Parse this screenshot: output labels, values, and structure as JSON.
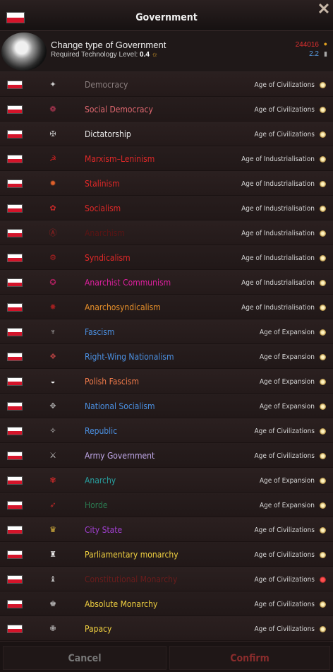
{
  "window": {
    "title": "Government"
  },
  "info": {
    "title": "Change type of Government",
    "req_label": "Required Technology Level: ",
    "req_value": "0.4",
    "gold": "244016",
    "time": "2.2"
  },
  "colors": {
    "gray": "#8a7f7f",
    "pink": "#e06870",
    "white": "#e8e8e8",
    "red": "#e02828",
    "darkred": "#5a1414",
    "magenta": "#e020a0",
    "orange": "#e8902a",
    "blue": "#4a8fe0",
    "salmon": "#f07a4a",
    "lavender": "#c0a8e8",
    "teal": "#28a0a0",
    "green": "#2a7a50",
    "purple": "#a040d0",
    "gold": "#f0d040",
    "maroon": "#6a1c1c"
  },
  "governments": [
    {
      "name": "Democracy",
      "age": "Age of Civilizations",
      "color": "#8a7f7f",
      "icon": "democracy-icon",
      "glyph": "✦",
      "icon_color": "#cfcfcf",
      "locked": false
    },
    {
      "name": "Social Democracy",
      "age": "Age of Civilizations",
      "color": "#e06870",
      "icon": "social-democracy-icon",
      "glyph": "❁",
      "icon_color": "#c03a5a",
      "locked": false
    },
    {
      "name": "Dictatorship",
      "age": "Age of Civilizations",
      "color": "#e8e8e8",
      "icon": "dictatorship-icon",
      "glyph": "✠",
      "icon_color": "#bdbdbd",
      "locked": false
    },
    {
      "name": "Marxism–Leninism",
      "age": "Age of Industrialisation",
      "color": "#e02828",
      "icon": "marxism-leninism-icon",
      "glyph": "☭",
      "icon_color": "#d02020",
      "locked": false
    },
    {
      "name": "Stalinism",
      "age": "Age of Industrialisation",
      "color": "#e02828",
      "icon": "stalinism-icon",
      "glyph": "✹",
      "icon_color": "#e0602a",
      "locked": false
    },
    {
      "name": "Socialism",
      "age": "Age of Industrialisation",
      "color": "#e02828",
      "icon": "socialism-icon",
      "glyph": "✿",
      "icon_color": "#c02828",
      "locked": false
    },
    {
      "name": "Anarchism",
      "age": "Age of Industrialisation",
      "color": "#5a1414",
      "icon": "anarchism-icon",
      "glyph": "Ⓐ",
      "icon_color": "#a02020",
      "locked": false
    },
    {
      "name": "Syndicalism",
      "age": "Age of Industrialisation",
      "color": "#e02828",
      "icon": "syndicalism-icon",
      "glyph": "⚙",
      "icon_color": "#b02020",
      "locked": false
    },
    {
      "name": "Anarchist Communism",
      "age": "Age of Industrialisation",
      "color": "#e020a0",
      "icon": "anarchist-communism-icon",
      "glyph": "✪",
      "icon_color": "#b02060",
      "locked": false
    },
    {
      "name": "Anarchosyndicalism",
      "age": "Age of Industrialisation",
      "color": "#e8902a",
      "icon": "anarchosyndicalism-icon",
      "glyph": "✸",
      "icon_color": "#a02020",
      "locked": false
    },
    {
      "name": "Fascism",
      "age": "Age of Expansion",
      "color": "#4a8fe0",
      "icon": "fascism-icon",
      "glyph": "♆",
      "icon_color": "#cccccc",
      "locked": false
    },
    {
      "name": "Right-Wing Nationalism",
      "age": "Age of Expansion",
      "color": "#4a8fe0",
      "icon": "right-wing-nationalism-icon",
      "glyph": "❖",
      "icon_color": "#b04040",
      "locked": false
    },
    {
      "name": "Polish Fascism",
      "age": "Age of Expansion",
      "color": "#f07a4a",
      "icon": "polish-fascism-icon",
      "glyph": "◒",
      "icon_color": "#f0f0f0",
      "locked": false
    },
    {
      "name": "National Socialism",
      "age": "Age of Expansion",
      "color": "#4a8fe0",
      "icon": "national-socialism-icon",
      "glyph": "✥",
      "icon_color": "#aaaaaa",
      "locked": false
    },
    {
      "name": "Republic",
      "age": "Age of Civilizations",
      "color": "#4a8fe0",
      "icon": "republic-icon",
      "glyph": "✧",
      "icon_color": "#cccccc",
      "locked": false
    },
    {
      "name": "Army Government",
      "age": "Age of Civilizations",
      "color": "#c0a8e8",
      "icon": "army-government-icon",
      "glyph": "⚔",
      "icon_color": "#cccccc",
      "locked": false
    },
    {
      "name": "Anarchy",
      "age": "Age of Expansion",
      "color": "#28a0a0",
      "icon": "anarchy-icon",
      "glyph": "✾",
      "icon_color": "#c02828",
      "locked": false
    },
    {
      "name": "Horde",
      "age": "Age of Expansion",
      "color": "#2a7a50",
      "icon": "horde-icon",
      "glyph": "➶",
      "icon_color": "#c02828",
      "locked": false
    },
    {
      "name": "City State",
      "age": "Age of Civilizations",
      "color": "#a040d0",
      "icon": "city-state-crown-icon",
      "glyph": "♛",
      "icon_color": "#e8c040",
      "locked": false
    },
    {
      "name": "Parliamentary monarchy",
      "age": "Age of Civilizations",
      "color": "#f0d040",
      "icon": "parliamentary-monarchy-icon",
      "glyph": "♜",
      "icon_color": "#e8e8e8",
      "locked": false
    },
    {
      "name": "Constitutional Monarchy",
      "age": "Age of Civilizations",
      "color": "#6a1c1c",
      "icon": "constitutional-monarchy-icon",
      "glyph": "♝",
      "icon_color": "#bdbdbd",
      "locked": true
    },
    {
      "name": "Absolute Monarchy",
      "age": "Age of Civilizations",
      "color": "#f0d040",
      "icon": "absolute-monarchy-icon",
      "glyph": "♚",
      "icon_color": "#bdbdbd",
      "locked": false
    },
    {
      "name": "Papacy",
      "age": "Age of Civilizations",
      "color": "#f0d040",
      "icon": "papacy-icon",
      "glyph": "✙",
      "icon_color": "#d0d0d0",
      "locked": false
    }
  ],
  "footer": {
    "cancel": "Cancel",
    "confirm": "Confirm"
  }
}
